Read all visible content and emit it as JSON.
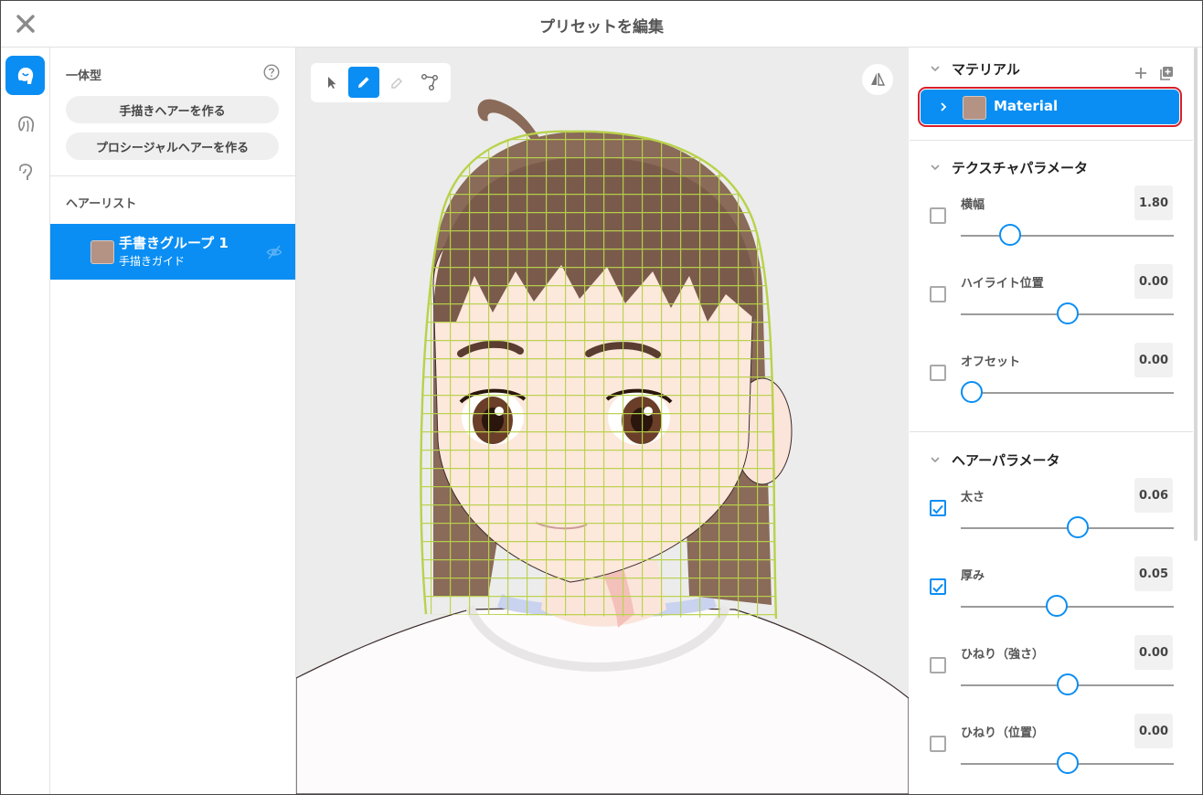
{
  "header": {
    "title": "プリセットを編集"
  },
  "hair_panel": {
    "type_label": "一体型",
    "create_hand_drawn": "手描きヘアーを作る",
    "create_procedural": "プロシージャルヘアーを作る",
    "list_label": "ヘアーリスト",
    "items": [
      {
        "name": "手書きグループ 1",
        "sub": "手描きガイド",
        "color": "#b49384"
      }
    ]
  },
  "material_section": {
    "title": "マテリアル",
    "material": {
      "name": "Material",
      "color": "#b49384"
    }
  },
  "texture_section": {
    "title": "テクスチャパラメータ",
    "params": [
      {
        "label": "横幅",
        "value": "1.80",
        "checked": false,
        "slider": 0.22
      },
      {
        "label": "ハイライト位置",
        "value": "0.00",
        "checked": false,
        "slider": 0.5
      },
      {
        "label": "オフセット",
        "value": "0.00",
        "checked": false,
        "slider": 0.0
      }
    ]
  },
  "hair_section": {
    "title": "ヘアーパラメータ",
    "params": [
      {
        "label": "太さ",
        "value": "0.06",
        "checked": true,
        "slider": 0.55
      },
      {
        "label": "厚み",
        "value": "0.05",
        "checked": true,
        "slider": 0.45
      },
      {
        "label": "ひねり（強さ）",
        "value": "0.00",
        "checked": false,
        "slider": 0.5
      },
      {
        "label": "ひねり（位置）",
        "value": "0.00",
        "checked": false,
        "slider": 0.5
      }
    ]
  },
  "colors": {
    "accent": "#0a8ef3",
    "highlight_border": "#d81e2a",
    "swatch": "#b49384"
  }
}
